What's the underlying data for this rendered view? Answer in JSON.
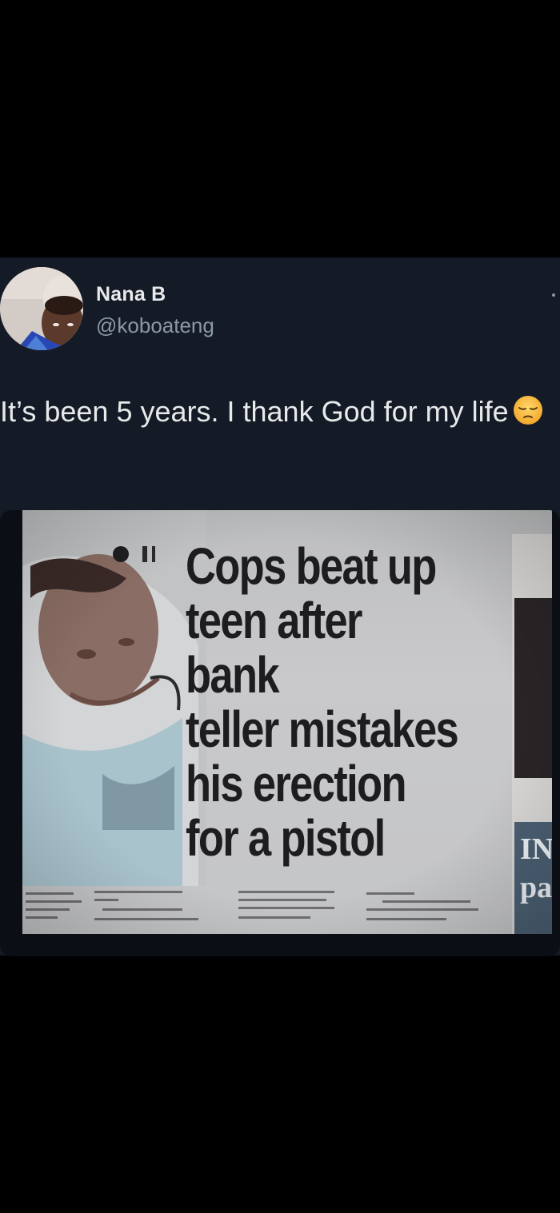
{
  "tweet": {
    "display_name": "Nana B",
    "handle": "@koboateng",
    "text": "It’s been 5 years. I thank God for my life",
    "emoji": "pensive-face",
    "media": {
      "headline_lines": [
        "Cops beat up",
        "teen after bank",
        "teller mistakes",
        "his erection",
        "for a pistol"
      ],
      "side_text_lines": [
        "IN",
        "pa"
      ]
    }
  },
  "colors": {
    "page_background": "#000000",
    "card_background": "#151b26",
    "text_primary": "#e7e9ea",
    "text_secondary": "#8b98a5",
    "newspaper": "#c4c5c7",
    "headline_ink": "#1d1d1f"
  },
  "icons": {
    "more": "more-dot-icon",
    "emoji": "pensive-face-icon"
  }
}
